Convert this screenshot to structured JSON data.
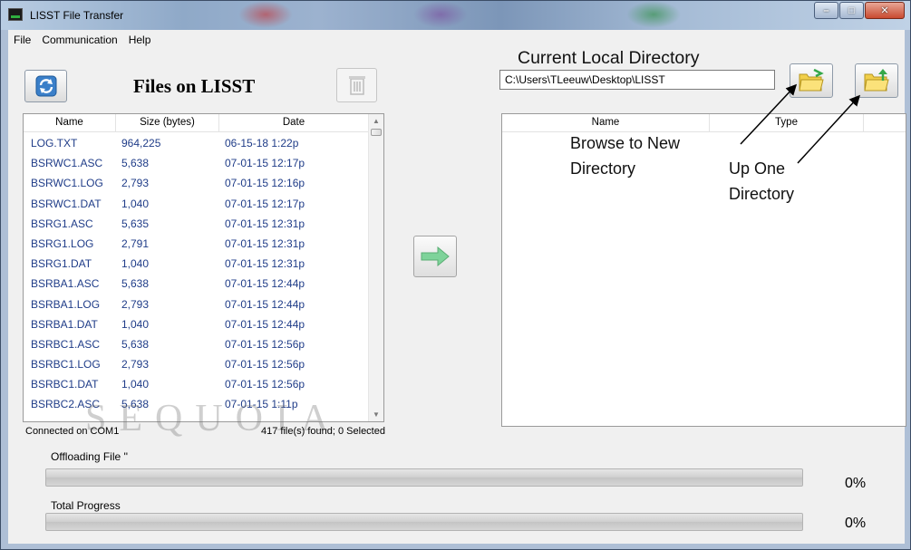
{
  "window": {
    "title": "LISST File Transfer",
    "app_icon_text": "LISST"
  },
  "menu": {
    "items": [
      "File",
      "Communication",
      "Help"
    ]
  },
  "left_panel": {
    "title": "Files on LISST",
    "columns": [
      "Name",
      "Size (bytes)",
      "Date"
    ],
    "rows": [
      [
        "LOG.TXT",
        "964,225",
        "06-15-18 1:22p"
      ],
      [
        "BSRWC1.ASC",
        "5,638",
        "07-01-15 12:17p"
      ],
      [
        "BSRWC1.LOG",
        "2,793",
        "07-01-15 12:16p"
      ],
      [
        "BSRWC1.DAT",
        "1,040",
        "07-01-15 12:17p"
      ],
      [
        "BSRG1.ASC",
        "5,635",
        "07-01-15 12:31p"
      ],
      [
        "BSRG1.LOG",
        "2,791",
        "07-01-15 12:31p"
      ],
      [
        "BSRG1.DAT",
        "1,040",
        "07-01-15 12:31p"
      ],
      [
        "BSRBA1.ASC",
        "5,638",
        "07-01-15 12:44p"
      ],
      [
        "BSRBA1.LOG",
        "2,793",
        "07-01-15 12:44p"
      ],
      [
        "BSRBA1.DAT",
        "1,040",
        "07-01-15 12:44p"
      ],
      [
        "BSRBC1.ASC",
        "5,638",
        "07-01-15 12:56p"
      ],
      [
        "BSRBC1.LOG",
        "2,793",
        "07-01-15 12:56p"
      ],
      [
        "BSRBC1.DAT",
        "1,040",
        "07-01-15 12:56p"
      ],
      [
        "BSRBC2.ASC",
        "5,638",
        "07-01-15 1:11p"
      ]
    ],
    "watermark": "SEQUOIA",
    "status_connection": "Connected on COM1",
    "status_count": "417 file(s) found; 0 Selected"
  },
  "right_panel": {
    "current_dir_label": "Current Local Directory",
    "current_dir_value": "C:\\Users\\TLeeuw\\Desktop\\LISST",
    "columns": [
      "Name",
      "Type"
    ],
    "annotation_browse": [
      "Browse to New",
      "Directory"
    ],
    "annotation_upone": [
      "Up One",
      "Directory"
    ]
  },
  "progress": {
    "offload_label": "Offloading File ''",
    "offload_fraction": 0,
    "offload_pct": "0%",
    "total_label": "Total Progress",
    "total_fraction": 0,
    "total_pct": "0%"
  },
  "icons": {
    "refresh": "refresh-icon",
    "trash": "trash-icon",
    "transfer": "arrow-right-icon",
    "browse": "folder-open-icon",
    "up_one": "folder-up-icon"
  }
}
